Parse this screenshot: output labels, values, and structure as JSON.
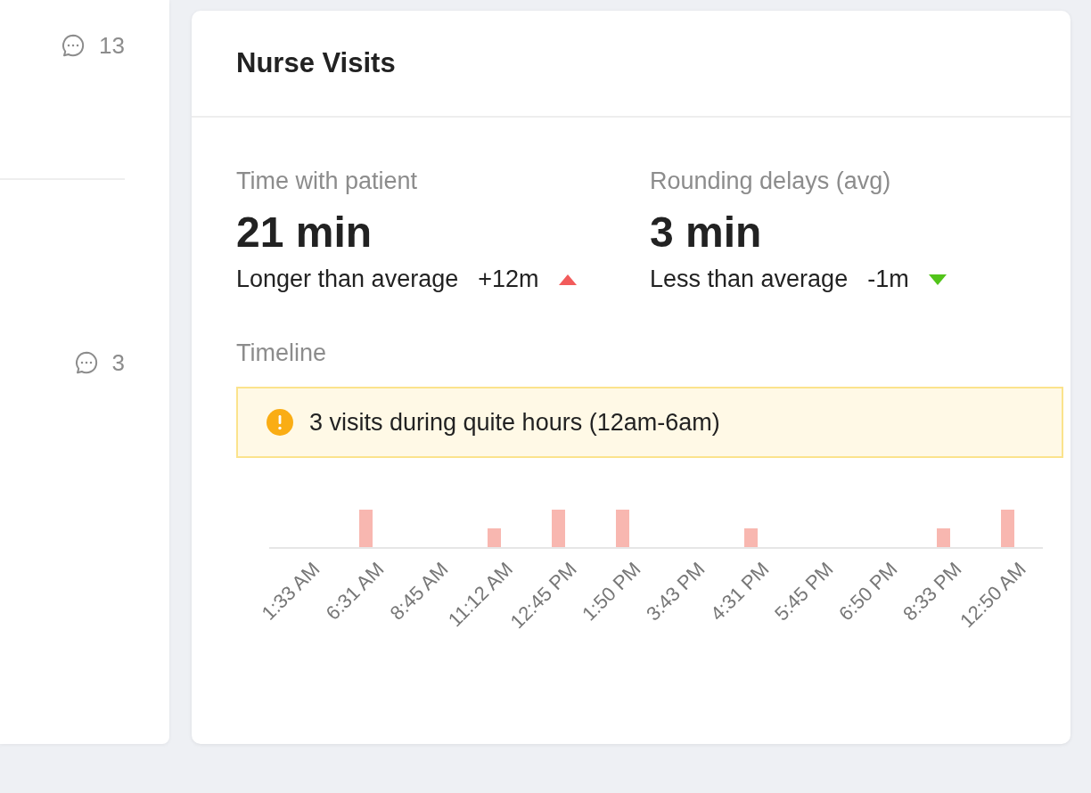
{
  "left_panel": {
    "comment_counts": [
      "13",
      "3"
    ]
  },
  "card": {
    "title": "Nurse Visits",
    "stats": [
      {
        "label": "Time with patient",
        "value": "21 min",
        "comparison": "Longer than average",
        "delta": "+12m",
        "kind": "increase"
      },
      {
        "label": "Rounding delays (avg)",
        "value": "3 min",
        "comparison": "Less than average",
        "delta": "-1m",
        "kind": "decrease"
      }
    ],
    "timeline": {
      "label": "Timeline",
      "alert": "3 visits during quite hours (12am-6am)",
      "slots": [
        {
          "label": "1:33 AM",
          "kind": "none"
        },
        {
          "label": "6:31 AM",
          "kind": "tall"
        },
        {
          "label": "8:45 AM",
          "kind": "none"
        },
        {
          "label": "11:12 AM",
          "kind": "short"
        },
        {
          "label": "12:45 PM",
          "kind": "tall"
        },
        {
          "label": "1:50 PM",
          "kind": "tall"
        },
        {
          "label": "3:43 PM",
          "kind": "none"
        },
        {
          "label": "4:31 PM",
          "kind": "short"
        },
        {
          "label": "5:45 PM",
          "kind": "none"
        },
        {
          "label": "6:50 PM",
          "kind": "none"
        },
        {
          "label": "8:33 PM",
          "kind": "short"
        },
        {
          "label": "12:50 AM",
          "kind": "tall"
        }
      ]
    }
  }
}
